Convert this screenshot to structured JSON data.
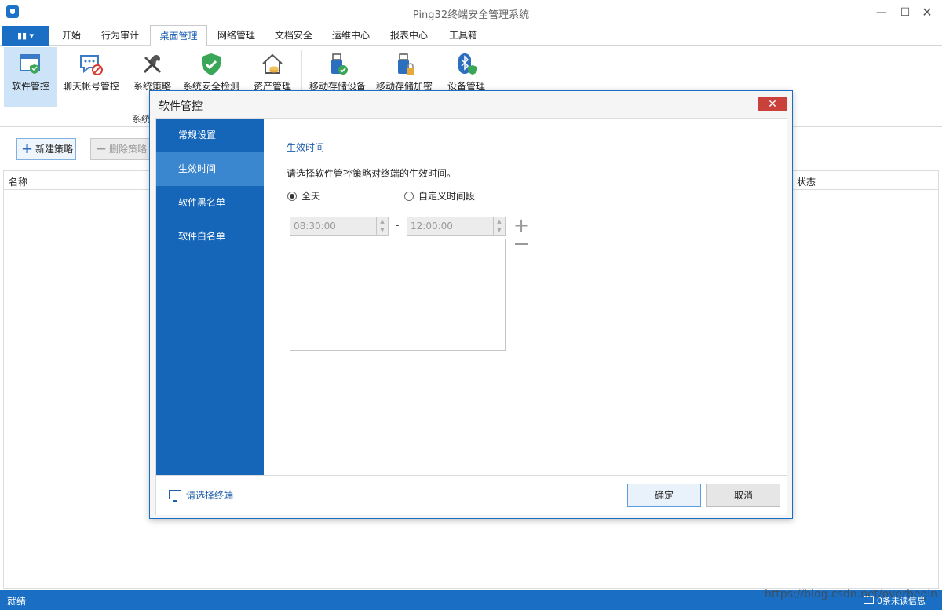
{
  "window": {
    "title": "Ping32终端安全管理系统",
    "minimize": "—",
    "maximize": "☐",
    "close": "✕"
  },
  "menu": {
    "file_glyph": "▮▮ ▾",
    "tabs": [
      "开始",
      "行为审计",
      "桌面管理",
      "网络管理",
      "文档安全",
      "运维中心",
      "报表中心",
      "工具箱"
    ],
    "active_tab": "桌面管理"
  },
  "ribbon": {
    "items": [
      {
        "label": "软件管控",
        "icon": "software-window-shield-icon"
      },
      {
        "label": "聊天帐号管控",
        "icon": "chat-forbidden-icon"
      },
      {
        "label": "系统策略",
        "icon": "tools-icon"
      },
      {
        "label": "系统安全检测",
        "icon": "shield-check-icon"
      },
      {
        "label": "资产管理",
        "icon": "house-coins-icon"
      },
      {
        "label": "移动存储设备",
        "icon": "usb-check-icon"
      },
      {
        "label": "移动存储加密",
        "icon": "usb-lock-icon"
      },
      {
        "label": "设备管理",
        "icon": "bluetooth-shield-icon"
      }
    ],
    "group_label": "系统"
  },
  "toolbar": {
    "new_label": "新建策略",
    "delete_label": "删除策略"
  },
  "list": {
    "columns": [
      "名称",
      "状态"
    ]
  },
  "statusbar": {
    "left": "就绪",
    "right": "0条未读信息"
  },
  "watermark": "https://blog.csdn.net/overbegin",
  "dialog": {
    "title": "软件管控",
    "nav": [
      "常规设置",
      "生效时间",
      "软件黑名单",
      "软件白名单"
    ],
    "active_nav": "生效时间",
    "section_title": "生效时间",
    "description": "请选择软件管控策略对终端的生效时间。",
    "radio_allday": "全天",
    "radio_custom": "自定义时间段",
    "selected_radio": "全天",
    "start_time": "08:30:00",
    "end_time": "12:00:00",
    "separator": "-",
    "select_terminal": "请选择终端",
    "ok": "确定",
    "cancel": "取消"
  },
  "colors": {
    "accent": "#1a6fc4",
    "nav_bg": "#1565b8",
    "nav_active": "#3a86cf",
    "close_red": "#c9413a"
  }
}
